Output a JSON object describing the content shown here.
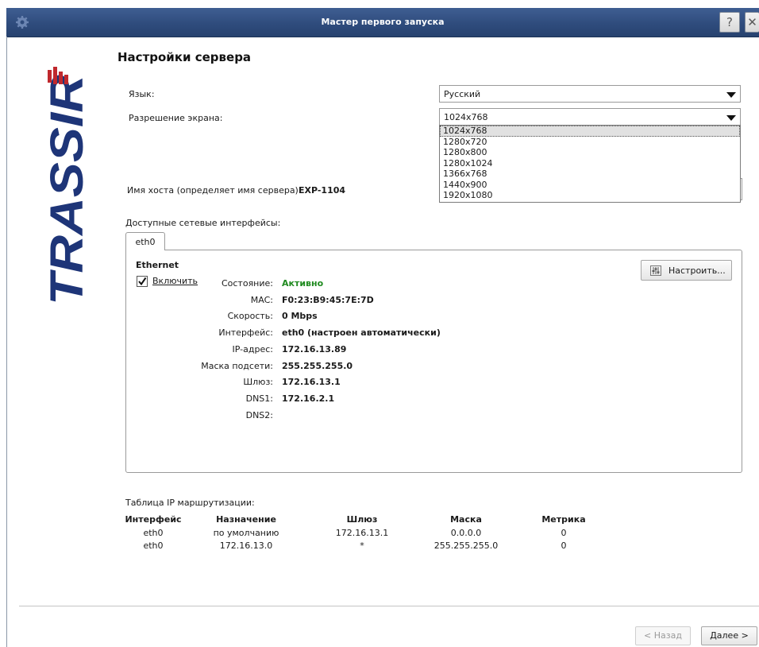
{
  "window": {
    "title": "Мастер первого запуска",
    "help_label": "?",
    "close_label": "✕"
  },
  "logo": {
    "text": "TRASSIR"
  },
  "page": {
    "title": "Настройки сервера"
  },
  "settings": {
    "language_label": "Язык:",
    "language_value": "Русский",
    "resolution_label": "Разрешение экрана:",
    "resolution_value": "1024x768",
    "resolution_options": [
      "1024x768",
      "1280x720",
      "1280x800",
      "1280x1024",
      "1366x768",
      "1440x900",
      "1920x1080"
    ],
    "hostname_label": "Имя хоста (определяет имя сервера):",
    "hostname_value": "EXP-1104"
  },
  "network": {
    "section_label": "Доступные сетевые интерфейсы:",
    "tab_label": "eth0",
    "type": "Ethernet",
    "enable_label": "Включить",
    "enable_checked": true,
    "configure_label": "Настроить...",
    "fields": [
      {
        "label": "Состояние:",
        "value": "Активно"
      },
      {
        "label": "MAC:",
        "value": "F0:23:B9:45:7E:7D"
      },
      {
        "label": "Скорость:",
        "value": "0 Mbps"
      },
      {
        "label": "Интерфейс:",
        "value": "eth0 (настроен автоматически)"
      },
      {
        "label": "IP-адрес:",
        "value": "172.16.13.89"
      },
      {
        "label": "Маска подсети:",
        "value": "255.255.255.0"
      },
      {
        "label": "Шлюз:",
        "value": "172.16.13.1"
      },
      {
        "label": "DNS1:",
        "value": "172.16.2.1"
      },
      {
        "label": "DNS2:",
        "value": ""
      }
    ],
    "status_color": "#1f8a1f"
  },
  "routing": {
    "title": "Таблица IP маршрутизации:",
    "headers": [
      "Интерфейс",
      "Назначение",
      "Шлюз",
      "Маска",
      "Метрика"
    ],
    "rows": [
      [
        "eth0",
        "по умолчанию",
        "172.16.13.1",
        "0.0.0.0",
        "0"
      ],
      [
        "eth0",
        "172.16.13.0",
        "*",
        "255.255.255.0",
        "0"
      ]
    ]
  },
  "footer": {
    "back_label": "< Назад",
    "next_label": "Далее >"
  },
  "colors": {
    "titlebar": "#2f4c7d",
    "logo": "#1e3578",
    "logo_accent": "#c0282d"
  }
}
